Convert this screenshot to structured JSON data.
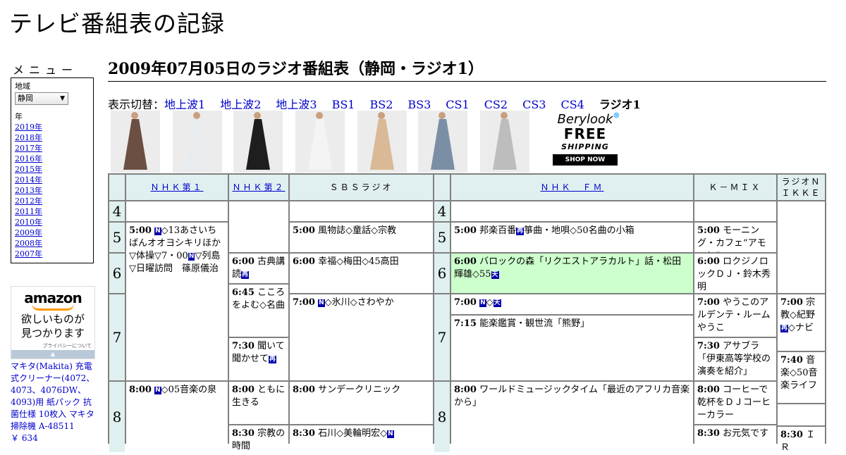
{
  "site_title": "テレビ番組表の記録",
  "menu": {
    "label": "メニュー",
    "region_label": "地域",
    "region_value": "静岡",
    "year_label": "年",
    "years": [
      "2019年",
      "2018年",
      "2017年",
      "2016年",
      "2015年",
      "2014年",
      "2013年",
      "2012年",
      "2011年",
      "2010年",
      "2009年",
      "2008年",
      "2007年"
    ]
  },
  "amazon_ad": {
    "logo": "amazon",
    "tagline_1": "欲しいものが",
    "tagline_2": "見つかります",
    "privacy": "プライバシーについて",
    "arrow": "▲"
  },
  "product": {
    "name": "マキタ(Makita) 充電式クリーナー(4072、4073、4076DW、4093)用 紙パック 抗菌仕様 10枚入 マキタ 掃除機 A-48511",
    "price": "￥ 634"
  },
  "page_title": "2009年07月05日のラジオ番組表（静岡・ラジオ1）",
  "switcher": {
    "label": "表示切替：",
    "links": [
      "地上波1",
      "地上波2",
      "地上波3",
      "BS1",
      "BS2",
      "BS3",
      "CS1",
      "CS2",
      "CS3",
      "CS4"
    ],
    "current": "ラジオ1"
  },
  "ad_strip": {
    "dress_colors": [
      "#6b4f43",
      "#e8ecef",
      "#1e1e1e",
      "#f4f4f4",
      "#d9b996",
      "#7b8fa4",
      "#bdbdbd"
    ],
    "promo_brand": "Berylook",
    "promo_free": "FREE",
    "promo_shipping": "SHIPPING",
    "promo_button": "SHOP NOW",
    "close_icon": "⊗"
  },
  "badges": {
    "news": "N",
    "rerun": "再",
    "weather": "天"
  },
  "channels": [
    "ＮＨＫ第１",
    "ＮＨＫ第２",
    "ＳＢＳラジオ",
    "ＮＨＫ　ＦＭ",
    "Ｋ－ＭＩＸ",
    "ラジオＮＩＫＫＥＩ"
  ],
  "hours": [
    "4",
    "5",
    "6",
    "7",
    "8"
  ],
  "programs": {
    "nhk1_1": {
      "time": "5:00",
      "text_a": "◇13あさいちばんオオヨシキリほか▽体操▽7・00",
      "text_b": "▽列島▽日曜訪問　篠原儀治"
    },
    "nhk1_2": {
      "time": "8:00",
      "text": "◇05音楽の泉"
    },
    "nhk2_1": {
      "time": "6:00",
      "text": "古典講読"
    },
    "nhk2_2": {
      "time": "6:45",
      "text": "こころをよむ◇名曲"
    },
    "nhk2_3": {
      "time": "7:30",
      "text": "聞いて聞かせて"
    },
    "nhk2_4": {
      "time": "8:00",
      "text": "ともに生きる"
    },
    "nhk2_5": {
      "time": "8:30",
      "text": "宗教の時間"
    },
    "sbs_1": {
      "time": "5:00",
      "text": "風物誌◇童話◇宗教"
    },
    "sbs_2": {
      "time": "6:00",
      "text": "幸福◇梅田◇45高田"
    },
    "sbs_3": {
      "time": "7:00",
      "text": "◇氷川◇さわやか"
    },
    "sbs_4": {
      "time": "8:00",
      "text": "サンデークリニック"
    },
    "sbs_5": {
      "time": "8:30",
      "text": "石川◇美輪明宏◇"
    },
    "fm_1": {
      "time": "5:00",
      "text_a": "邦楽百番",
      "text_b": "箏曲・地唄◇50名曲の小箱"
    },
    "fm_2": {
      "time": "6:00",
      "text": "バロックの森「リクエストアラカルト」話・松田輝雄◇55"
    },
    "fm_3": {
      "time": "7:00",
      "text": "◇"
    },
    "fm_4": {
      "time": "7:15",
      "text": "能楽鑑賞・観世流「熊野」"
    },
    "fm_5": {
      "time": "8:00",
      "text": "ワールドミュージックタイム「最近のアフリカ音楽から」"
    },
    "kmix_1": {
      "time": "5:00",
      "text": "モーニング・カフェ“アモーレ”"
    },
    "kmix_2": {
      "time": "6:00",
      "text": "ロクジノロックＤＪ・鈴木秀明"
    },
    "kmix_3": {
      "time": "7:00",
      "text": "やうこのアルデンテ・ルームやうこ"
    },
    "kmix_4": {
      "time": "7:30",
      "text": "アサブラ「伊東高等学校の演奏を紹介」"
    },
    "kmix_5": {
      "time": "8:00",
      "text": "コーヒーで乾杯をＤＪコーヒーカラー"
    },
    "kmix_6": {
      "time": "8:30",
      "text": "お元気です"
    },
    "nikkei_1": {
      "time": "7:00",
      "text_a": "宗教◇紀野",
      "text_b": "◇ナビ"
    },
    "nikkei_2": {
      "time": "7:40",
      "text": "音楽◇50音楽ライフ"
    },
    "nikkei_3": {
      "time": "8:30",
      "text": "ＩＲ"
    }
  }
}
